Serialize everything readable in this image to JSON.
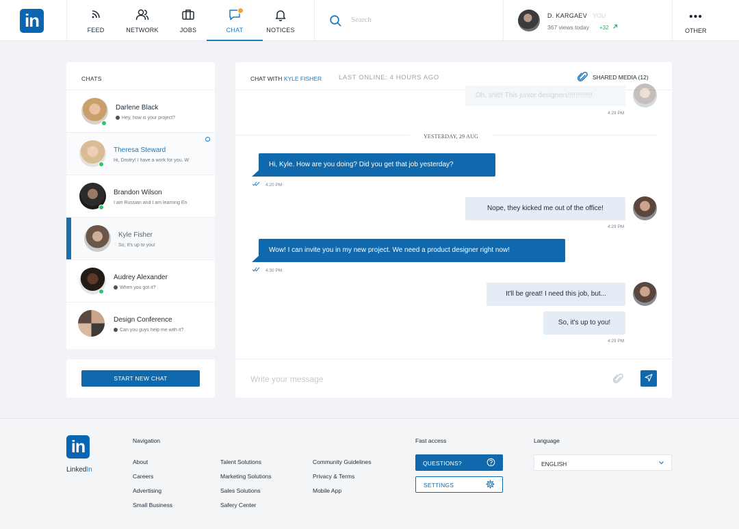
{
  "header": {
    "logo_text": "in",
    "nav": [
      {
        "label": "FEED",
        "icon": "rss-icon"
      },
      {
        "label": "NETWORK",
        "icon": "people-icon"
      },
      {
        "label": "JOBS",
        "icon": "briefcase-icon"
      },
      {
        "label": "CHAT",
        "icon": "chat-bubble-icon",
        "active": true,
        "badge": true
      },
      {
        "label": "NOTICES",
        "icon": "bell-icon"
      }
    ],
    "search_placeholder": "Search",
    "profile": {
      "name": "D. KARGAEV",
      "you": "YOU",
      "views": "367 views today",
      "delta": "+32"
    },
    "other_label": "OTHER"
  },
  "sidebar": {
    "title": "CHATS",
    "chats": [
      {
        "name": "Darlene Black",
        "preview": "Hey, how is your project?",
        "online": true
      },
      {
        "name": "Theresa Steward",
        "preview": "Hi, Dmitry! I have a work for you. W",
        "online": true,
        "unread": true
      },
      {
        "name": "Brandon Wilson",
        "preview": "I am Russian and I am learning En",
        "online": true
      },
      {
        "name": "Kyle Fisher",
        "preview": "So, It's up to you!",
        "selected": true
      },
      {
        "name": "Audrey Alexander",
        "preview": "When you got it?",
        "online": true
      },
      {
        "name": "Design Conference",
        "preview": "Can you guys help me with it?"
      }
    ],
    "start_button": "START NEW CHAT"
  },
  "chat": {
    "with_prefix": "CHAT WITH",
    "with_name": "KYLE FISHER",
    "last_online": "LAST ONLINE: 4 HOURS AGO",
    "shared_media": "SHARED MEDIA (12)",
    "day_label": "YESTERDAY, 29 AUG",
    "messages": [
      {
        "text": "Oh, shit!! This junior designers!!!!!!!!!!!!!",
        "time": "4:29 PM",
        "direction": "out",
        "faded": true
      },
      {
        "text": "Hi, Kyle. How are you doing? Did you get that job yesterday?",
        "time": "4:20 PM",
        "direction": "in"
      },
      {
        "text": "Nope, they kicked me out of the office!",
        "time": "4:29 PM",
        "direction": "out"
      },
      {
        "text": "Wow! I can invite you in my new project. We need a product designer right now!",
        "time": "4:30 PM",
        "direction": "in"
      },
      {
        "text": "It'll be great! I need this job, but...",
        "direction": "out"
      },
      {
        "text": "So, it's up to you!",
        "time": "4:29 PM",
        "direction": "out"
      }
    ],
    "input_placeholder": "Write your message"
  },
  "footer": {
    "logo_text": "in",
    "brand_prefix": "Linked",
    "brand_suffix": "In",
    "navigation_title": "Navigation",
    "nav_col1": [
      "About",
      "Careers",
      "Advertising",
      "Small Business"
    ],
    "nav_col2": [
      "Talent Solutions",
      "Marketing Solutions",
      "Sales Solutions",
      "Safery Center"
    ],
    "nav_col3": [
      "Community Guidelines",
      "Privacy & Terms",
      "Mobile App"
    ],
    "fast_access_title": "Fast access",
    "questions_button": "QUESTIONS?",
    "settings_button": "SETTINGS",
    "language_title": "Language",
    "language_value": "ENGLISH"
  },
  "colors": {
    "brand": "#0a66b3",
    "accent": "#1a7ac2",
    "online": "#2ec56b",
    "badge": "#f2a33a"
  }
}
